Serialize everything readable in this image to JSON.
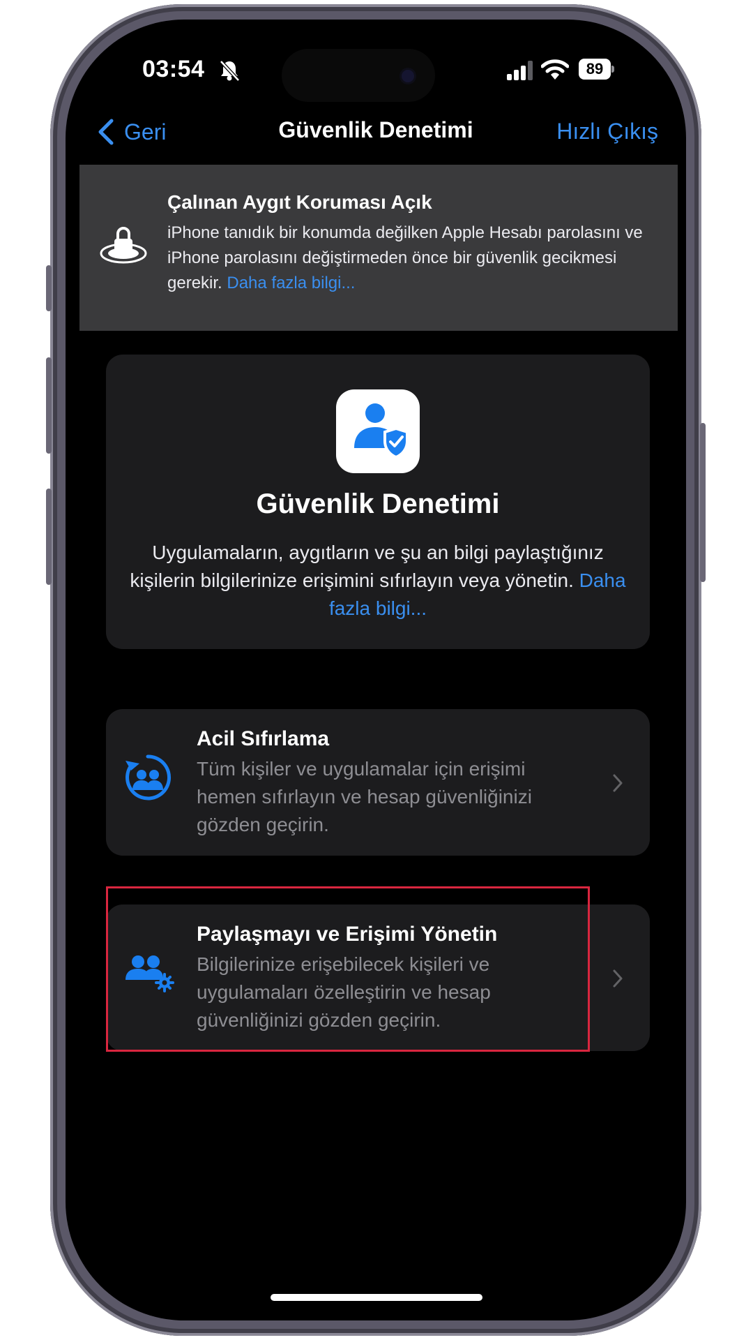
{
  "status_bar": {
    "time": "03:54",
    "battery": "89"
  },
  "nav": {
    "back_label": "Geri",
    "title": "Güvenlik Denetimi",
    "exit_label": "Hızlı Çıkış"
  },
  "banner": {
    "title": "Çalınan Aygıt Koruması Açık",
    "text": "iPhone tanıdık bir konumda değilken Apple Hesabı parolasını ve iPhone parolasını değiştirmeden önce bir güvenlik gecikmesi gerekir.",
    "link": "Daha fazla bilgi..."
  },
  "main_card": {
    "title": "Güvenlik Denetimi",
    "text": "Uygulamaların, aygıtların ve şu an bilgi paylaştığınız kişilerin bilgilerinize erişimini sıfırlayın veya yönetin.",
    "link": "Daha fazla bilgi..."
  },
  "options": [
    {
      "title": "Acil Sıfırlama",
      "description": "Tüm kişiler ve uygulamalar için erişimi hemen sıfırlayın ve hesap güvenliğinizi gözden geçirin.",
      "icon": "emergency-reset-icon"
    },
    {
      "title": "Paylaşmayı ve Erişimi Yönetin",
      "description": "Bilgilerinize erişebilecek kişileri ve uygulamaları özelleştirin ve hesap güvenliğinizi gözden geçirin.",
      "icon": "manage-sharing-icon"
    }
  ],
  "colors": {
    "accent": "#3a8ff0",
    "highlight": "#d9263f",
    "card": "#1c1c1e",
    "banner": "#3a3a3c"
  }
}
